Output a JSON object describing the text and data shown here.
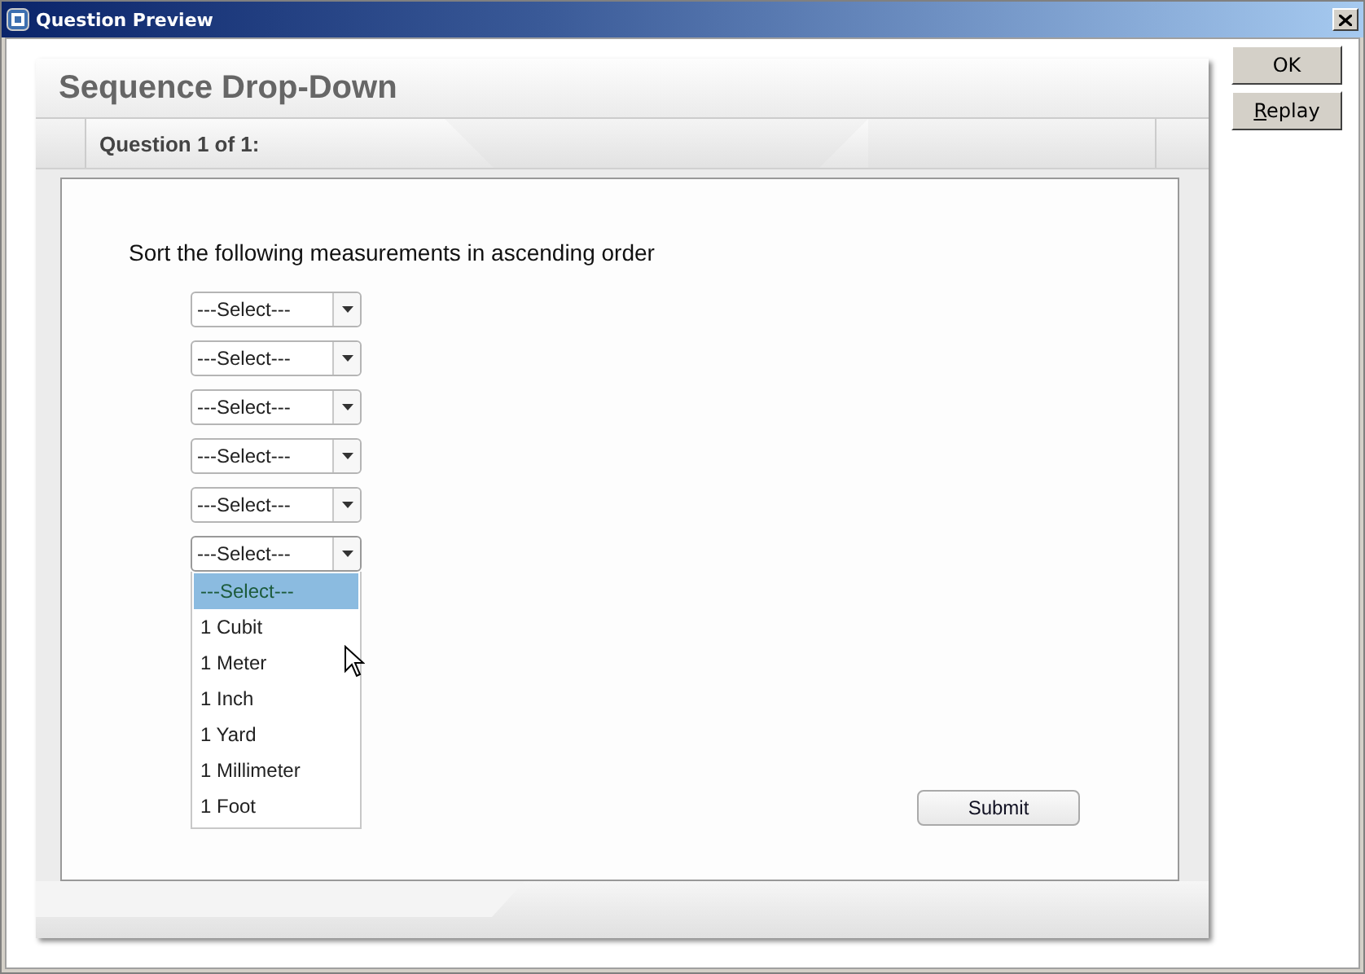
{
  "window": {
    "title": "Question Preview"
  },
  "side_buttons": [
    {
      "label": "OK"
    },
    {
      "label": "Replay"
    }
  ],
  "question": {
    "heading": "Sequence Drop-Down",
    "counter": "Question 1 of 1:",
    "prompt": "Sort the following measurements in ascending order",
    "dropdowns": [
      {
        "value": "---Select---",
        "expanded": false
      },
      {
        "value": "---Select---",
        "expanded": false
      },
      {
        "value": "---Select---",
        "expanded": false
      },
      {
        "value": "---Select---",
        "expanded": false
      },
      {
        "value": "---Select---",
        "expanded": false
      },
      {
        "value": "---Select---",
        "expanded": true,
        "options": [
          {
            "label": "---Select---",
            "selected": true
          },
          {
            "label": "1 Cubit",
            "selected": false
          },
          {
            "label": "1 Meter",
            "selected": false
          },
          {
            "label": "1 Inch",
            "selected": false
          },
          {
            "label": "1 Yard",
            "selected": false
          },
          {
            "label": "1 Millimeter",
            "selected": false
          },
          {
            "label": "1 Foot",
            "selected": false
          }
        ]
      }
    ],
    "submit": "Submit"
  }
}
